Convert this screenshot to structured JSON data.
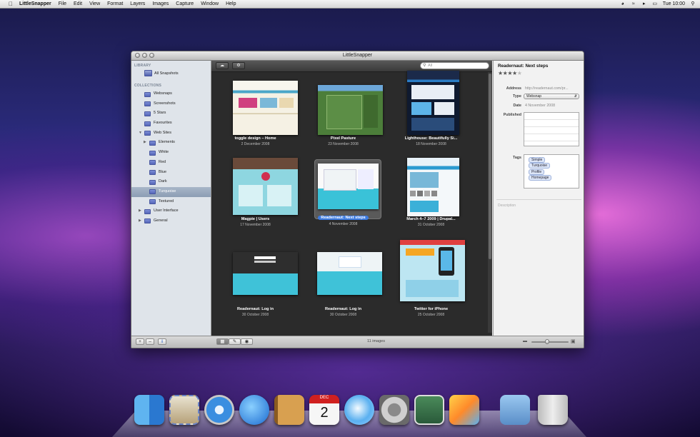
{
  "menubar": {
    "app_name": "LittleSnapper",
    "menus": [
      "File",
      "Edit",
      "View",
      "Format",
      "Layers",
      "Images",
      "Capture",
      "Window",
      "Help"
    ],
    "clock": "Tue 10:00"
  },
  "window": {
    "title": "LittleSnapper"
  },
  "sidebar": {
    "library_header": "LIBRARY",
    "library_items": [
      "All Snapshots"
    ],
    "collections_header": "COLLECTIONS",
    "collection_items": [
      {
        "label": "Websnaps"
      },
      {
        "label": "Screenshots"
      },
      {
        "label": "5 Stars"
      },
      {
        "label": "Favourites"
      },
      {
        "label": "Web Sites"
      },
      {
        "label": "Elements"
      },
      {
        "label": "White"
      },
      {
        "label": "Red"
      },
      {
        "label": "Blue"
      },
      {
        "label": "Dark"
      },
      {
        "label": "Turquoise"
      },
      {
        "label": "Textured"
      },
      {
        "label": "User Interface"
      },
      {
        "label": "General"
      }
    ]
  },
  "browser": {
    "search_placeholder": "All",
    "items": [
      {
        "title": "toggle design – Home",
        "date": "2 December 2008"
      },
      {
        "title": "Pixel Pasture",
        "date": "23 November 2008"
      },
      {
        "title": "Lighthouse: Beautifully Si...",
        "date": "18 November 2008"
      },
      {
        "title": "Magpie | Users",
        "date": "17 November 2008"
      },
      {
        "title": "Readernaut: Next steps",
        "date": "4 November 2008"
      },
      {
        "title": "March 4–7 2009 | Drupal...",
        "date": "31 October 2008"
      },
      {
        "title": "Readernaut: Log in",
        "date": "30 October 2008"
      },
      {
        "title": "Readernaut: Log in",
        "date": "30 October 2008"
      },
      {
        "title": "Twitter for iPhone",
        "date": "25 October 2008"
      }
    ],
    "count_label": "11 images"
  },
  "inspector": {
    "title": "Readernaut: Next steps",
    "rating": 4,
    "address_label": "Address",
    "address_value": "http://readernaut.com/pr...",
    "type_label": "Type",
    "type_value": "Websnap",
    "date_label": "Date",
    "date_value": "4 November 2008",
    "published_label": "Published",
    "tags_label": "Tags",
    "tags": [
      "Simple",
      "Turquoise",
      "Profile",
      "Homepage"
    ],
    "description_placeholder": "Description"
  },
  "bottombar": {
    "add_symbol": "+",
    "remove_symbol": "–",
    "info_symbol": "i"
  }
}
